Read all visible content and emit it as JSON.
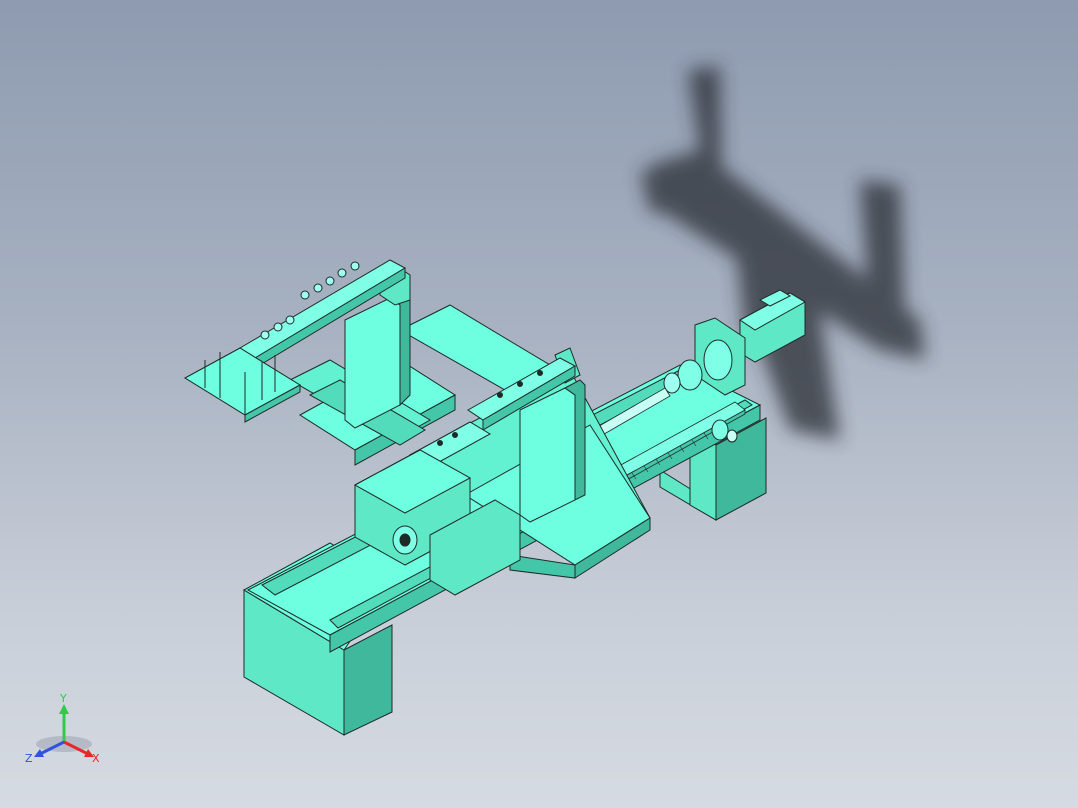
{
  "viewport": {
    "background_top": "#8e9bb0",
    "background_bottom": "#d6dbe2",
    "model_color": "#66ffdd",
    "model_shade": "#46c9ad",
    "edge_color": "#1d2b28",
    "shadow_color": "#2a2f36"
  },
  "triad": {
    "x_label": "X",
    "y_label": "Y",
    "z_label": "Z",
    "x_color": "#e8262b",
    "y_color": "#31c94a",
    "z_color": "#2f52e0"
  }
}
